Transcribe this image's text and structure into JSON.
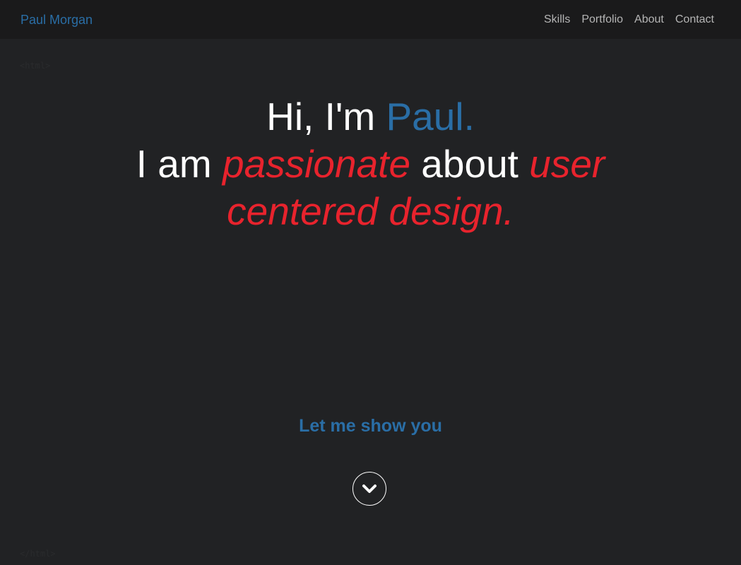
{
  "navbar": {
    "brand": "Paul Morgan",
    "links": [
      "Skills",
      "Portfolio",
      "About",
      "Contact"
    ]
  },
  "code_tags": {
    "open": "<html>",
    "close": "</html>"
  },
  "hero": {
    "greeting_prefix": "Hi, I'm ",
    "greeting_name": "Paul.",
    "line2_prefix": "I am ",
    "line2_em1": "passionate",
    "line2_mid": " about ",
    "line2_em2": "user centered design."
  },
  "cta": {
    "label": "Let me show you"
  },
  "icons": {
    "scroll": "chevron-down-icon"
  },
  "colors": {
    "background": "#212224",
    "navbar": "#1a1a1b",
    "accent_blue": "#2a6ea6",
    "accent_red": "#e8232d",
    "nav_text": "#b5b5b5"
  }
}
